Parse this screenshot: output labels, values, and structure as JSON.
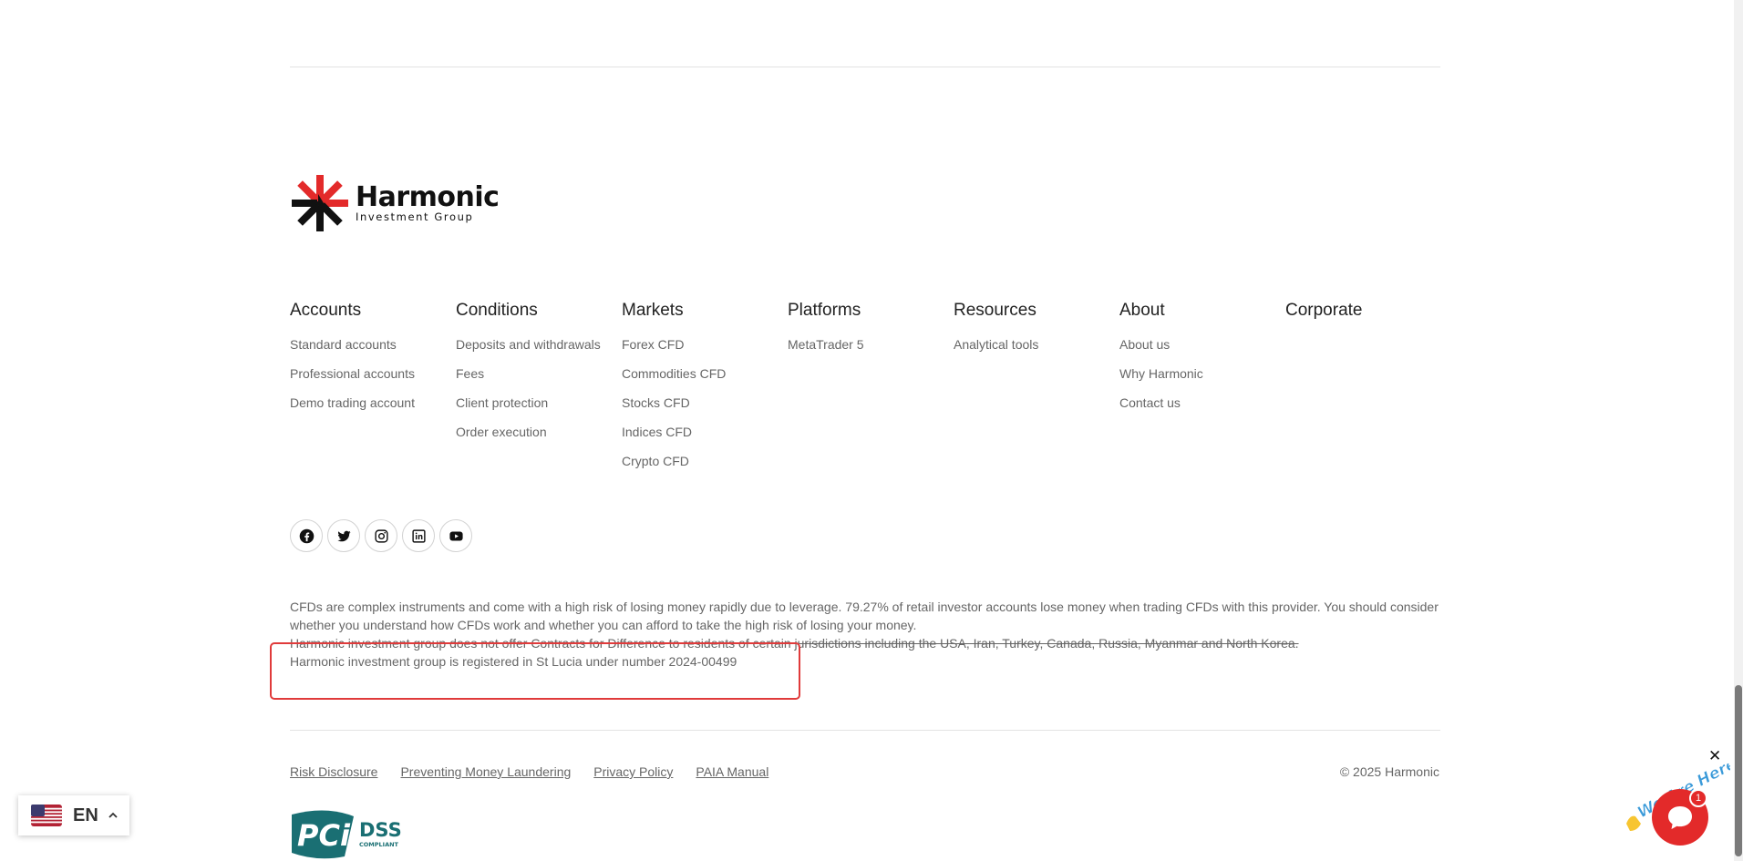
{
  "logo": {
    "name": "Harmonic",
    "subtitle": "Investment Group"
  },
  "columns": [
    {
      "title": "Accounts",
      "items": [
        "Standard accounts",
        "Professional accounts",
        "Demo trading account"
      ]
    },
    {
      "title": "Conditions",
      "items": [
        "Deposits and withdrawals",
        "Fees",
        "Client protection",
        "Order execution"
      ]
    },
    {
      "title": "Markets",
      "items": [
        "Forex CFD",
        "Commodities CFD",
        "Stocks CFD",
        "Indices CFD",
        "Crypto CFD"
      ]
    },
    {
      "title": "Platforms",
      "items": [
        "MetaTrader 5"
      ]
    },
    {
      "title": "Resources",
      "items": [
        "Analytical tools"
      ]
    },
    {
      "title": "About",
      "items": [
        "About us",
        "Why Harmonic",
        "Contact us"
      ]
    },
    {
      "title": "Corporate",
      "items": []
    }
  ],
  "social": [
    "facebook-icon",
    "twitter-icon",
    "instagram-icon",
    "linkedin-icon",
    "youtube-icon"
  ],
  "disclaimer": {
    "line1": "CFDs are complex instruments and come with a high risk of losing money rapidly due to leverage. 79.27% of retail investor accounts lose money when trading CFDs with this provider. You should consider whether you understand how CFDs work and whether you can afford to take the high risk of losing your money.",
    "line2": "Harmonic investment group does not offer Contracts for Difference to residents of certain jurisdictions including the USA, Iran, Turkey, Canada, Russia, Myanmar and North Korea.",
    "line3": "Harmonic investment group is registered in St Lucia under number 2024-00499"
  },
  "legal_links": [
    "Risk Disclosure",
    "Preventing Money Laundering",
    "Privacy Policy",
    "PAIA Manual"
  ],
  "copyright": "© 2025 Harmonic",
  "pci": {
    "main": "PCi",
    "dss": "DSS",
    "compliant": "COMPLIANT"
  },
  "language": {
    "code": "EN"
  },
  "chat": {
    "banner": "We Are Here!",
    "badge": "1",
    "close": "✕"
  },
  "colors": {
    "brand_red": "#e32a2a",
    "pci_teal": "#1a6f73",
    "highlight": "#e03b3b"
  }
}
